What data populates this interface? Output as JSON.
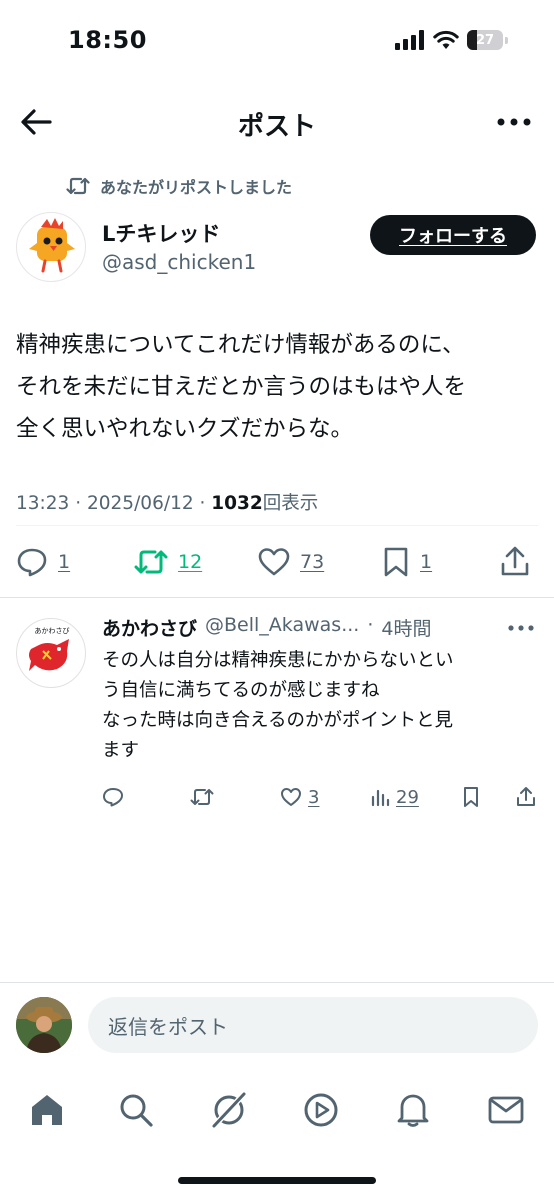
{
  "status_bar": {
    "time": "18:50",
    "battery_percent": "27",
    "battery_level": 0.27
  },
  "header": {
    "title": "ポスト"
  },
  "repost": {
    "text": "あなたがリポストしました"
  },
  "author": {
    "name": "Lチキレッド",
    "handle": "@asd_chicken1",
    "follow_label": "フォローする"
  },
  "post": {
    "lines": [
      "精神疾患についてこれだけ情報があるのに、",
      "それを未だに甘えだとか言うのはもはや人を",
      "全く思いやれないクズだからな。"
    ],
    "meta": {
      "time": "13:23",
      "sep1": " · ",
      "date": "2025/06/12",
      "sep2": " · ",
      "views": "1032",
      "views_label": "回表示"
    },
    "actions": {
      "replies": "1",
      "reposts": "12",
      "likes": "73",
      "bookmarks": "1"
    }
  },
  "reply": {
    "name": "あかわさび",
    "handle": "@Bell_Akawas...",
    "sep": "·",
    "time": "4時間",
    "lines": [
      "その人は自分は精神疾患にかからないとい",
      "う自信に満ちてるのが感じますね",
      "なった時は向き合えるのかがポイントと見",
      "ます"
    ],
    "avatar_label": "あかわさび",
    "actions": {
      "likes": "3",
      "views": "29"
    }
  },
  "compose": {
    "placeholder": "返信をポスト"
  },
  "colors": {
    "text": "#0f1419",
    "secondary": "#536471",
    "repost_green": "#00ba7c",
    "reply_bird": "#e0262d"
  }
}
